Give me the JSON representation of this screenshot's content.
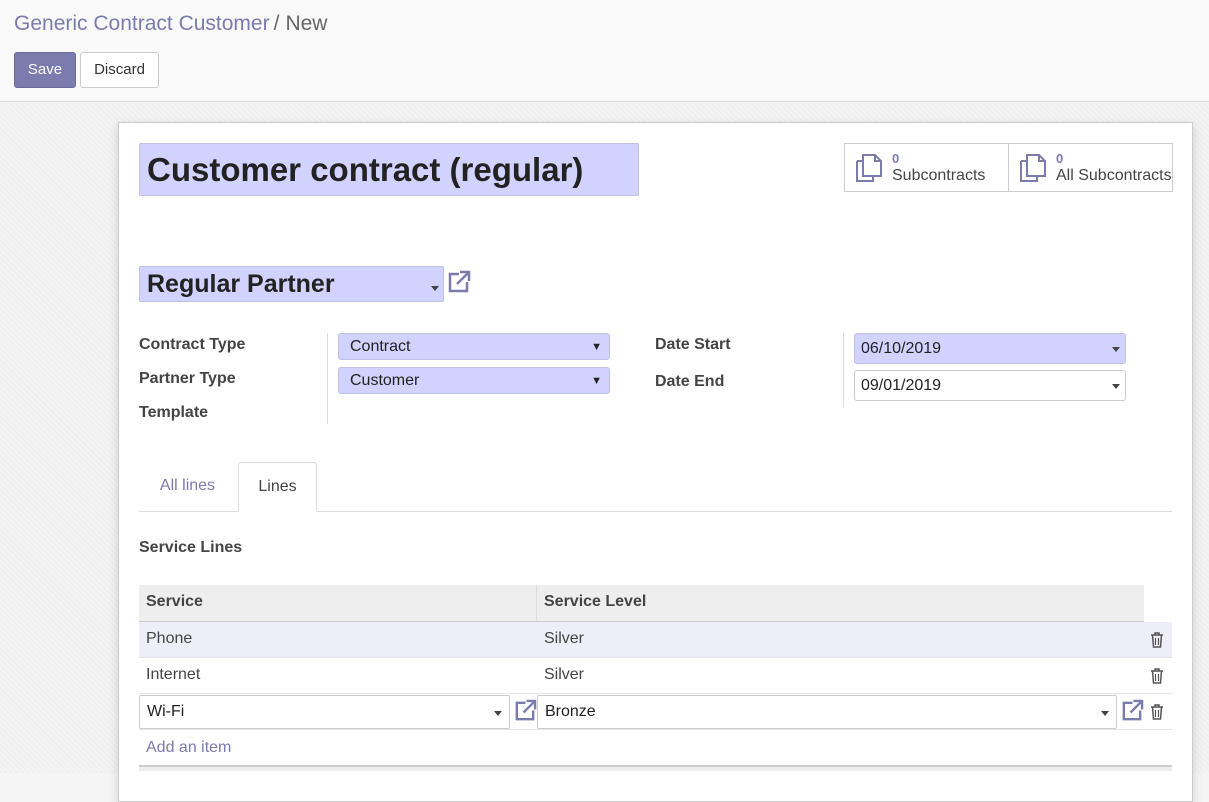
{
  "breadcrumb": {
    "parent": "Generic Contract Customer",
    "separator": "/",
    "current": "New"
  },
  "toolbar": {
    "save_label": "Save",
    "discard_label": "Discard"
  },
  "form": {
    "title": "Customer contract (regular)",
    "partner": "Regular Partner",
    "stat_buttons": [
      {
        "value": "0",
        "label": "Subcontracts",
        "icon": "copy-icon"
      },
      {
        "value": "0",
        "label": "All Subcontracts",
        "icon": "copy-icon"
      }
    ],
    "fields": {
      "contract_type_label": "Contract Type",
      "contract_type_value": "Contract",
      "partner_type_label": "Partner Type",
      "partner_type_value": "Customer",
      "template_label": "Template",
      "date_start_label": "Date Start",
      "date_start_value": "06/10/2019",
      "date_end_label": "Date End",
      "date_end_value": "09/01/2019"
    },
    "tabs": [
      {
        "label": "All lines",
        "active": false
      },
      {
        "label": "Lines",
        "active": true
      }
    ],
    "section_title": "Service Lines",
    "table": {
      "headers": [
        "Service",
        "Service Level"
      ],
      "rows": [
        {
          "service": "Phone",
          "level": "Silver"
        },
        {
          "service": "Internet",
          "level": "Silver"
        }
      ],
      "edit_row": {
        "service": "Wi-Fi",
        "level": "Bronze"
      },
      "add_item_label": "Add an item"
    }
  },
  "colors": {
    "accent": "#7c7bad",
    "required_field_bg": "#d2d2ff",
    "row_highlight": "#eeeef8"
  }
}
